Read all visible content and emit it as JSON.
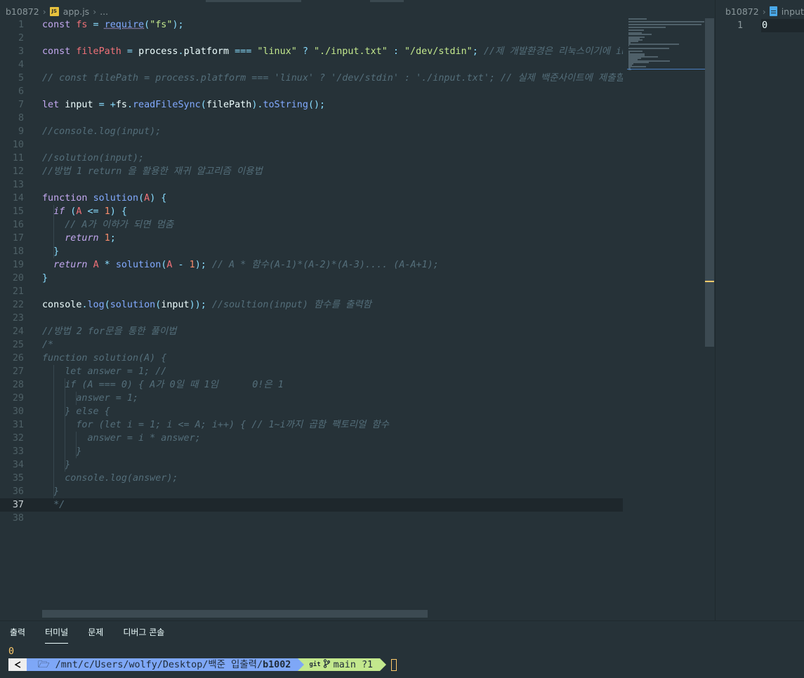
{
  "left_breadcrumb": {
    "folder": "b10872",
    "file": "app.js",
    "more": "...",
    "file_icon": "js-file-icon"
  },
  "right_breadcrumb": {
    "folder": "b10872",
    "file": "input",
    "file_icon": "text-file-icon"
  },
  "editor": {
    "current_line": 37,
    "lines": [
      [
        [
          "t-keyword",
          "const "
        ],
        [
          "t-var",
          "fs"
        ],
        [
          "t-op",
          " = "
        ],
        [
          "t-fn t-underline",
          "require"
        ],
        [
          "t-punc",
          "("
        ],
        [
          "t-str",
          "\"fs\""
        ],
        [
          "t-punc",
          ");"
        ]
      ],
      [],
      [
        [
          "t-keyword",
          "const "
        ],
        [
          "t-var",
          "filePath"
        ],
        [
          "t-op",
          " = "
        ],
        [
          "t-plain",
          "process"
        ],
        [
          "t-punc",
          "."
        ],
        [
          "t-plain",
          "platform"
        ],
        [
          "t-op",
          " === "
        ],
        [
          "t-str",
          "\"linux\""
        ],
        [
          "t-op",
          " ? "
        ],
        [
          "t-str",
          "\"./input.txt\""
        ],
        [
          "t-op",
          " : "
        ],
        [
          "t-str",
          "\"/dev/stdin\""
        ],
        [
          "t-punc",
          "; "
        ],
        [
          "t-comment",
          "//제 개발환경은 리눅스이기에 input.txt"
        ]
      ],
      [],
      [
        [
          "t-comment",
          "// const filePath = process.platform === 'linux' ? '/dev/stdin' : './input.txt'; // 실제 백준사이트에 제출할 때"
        ]
      ],
      [],
      [
        [
          "t-keyword",
          "let "
        ],
        [
          "t-plain",
          "input"
        ],
        [
          "t-op",
          " = +"
        ],
        [
          "t-plain",
          "fs"
        ],
        [
          "t-punc",
          "."
        ],
        [
          "t-fn",
          "readFileSync"
        ],
        [
          "t-punc",
          "("
        ],
        [
          "t-plain",
          "filePath"
        ],
        [
          "t-punc",
          ")."
        ],
        [
          "t-fn",
          "toString"
        ],
        [
          "t-punc",
          "();"
        ]
      ],
      [],
      [
        [
          "t-comment",
          "//console.log(input);"
        ]
      ],
      [],
      [
        [
          "t-comment",
          "//solution(input);"
        ]
      ],
      [
        [
          "t-comment",
          "//방법 1 return 을 활용한 재귀 알고리즘 이용법"
        ]
      ],
      [],
      [
        [
          "t-keyword",
          "function "
        ],
        [
          "t-fn",
          "solution"
        ],
        [
          "t-punc",
          "("
        ],
        [
          "t-var",
          "A"
        ],
        [
          "t-punc",
          ") {"
        ]
      ],
      [
        [
          "t-plain",
          "  "
        ],
        [
          "t-ctrl",
          "if"
        ],
        [
          "t-punc",
          " ("
        ],
        [
          "t-var",
          "A"
        ],
        [
          "t-op",
          " <= "
        ],
        [
          "t-num",
          "1"
        ],
        [
          "t-punc",
          ") {"
        ]
      ],
      [
        [
          "t-plain",
          "    "
        ],
        [
          "t-comment",
          "// A가 이하가 되면 멈춤"
        ]
      ],
      [
        [
          "t-plain",
          "    "
        ],
        [
          "t-ctrl",
          "return "
        ],
        [
          "t-num",
          "1"
        ],
        [
          "t-punc",
          ";"
        ]
      ],
      [
        [
          "t-punc",
          "  }"
        ]
      ],
      [
        [
          "t-plain",
          "  "
        ],
        [
          "t-ctrl",
          "return "
        ],
        [
          "t-var",
          "A"
        ],
        [
          "t-op",
          " * "
        ],
        [
          "t-fn",
          "solution"
        ],
        [
          "t-punc",
          "("
        ],
        [
          "t-var",
          "A"
        ],
        [
          "t-op",
          " - "
        ],
        [
          "t-num",
          "1"
        ],
        [
          "t-punc",
          "); "
        ],
        [
          "t-comment",
          "// A * 함수(A-1)*(A-2)*(A-3).... (A-A+1);"
        ]
      ],
      [
        [
          "t-punc",
          "}"
        ]
      ],
      [],
      [
        [
          "t-plain",
          "console"
        ],
        [
          "t-punc",
          "."
        ],
        [
          "t-fn",
          "log"
        ],
        [
          "t-punc",
          "("
        ],
        [
          "t-fn",
          "solution"
        ],
        [
          "t-punc",
          "("
        ],
        [
          "t-plain",
          "input"
        ],
        [
          "t-punc",
          "));"
        ],
        [
          "t-plain",
          " "
        ],
        [
          "t-comment",
          "//soultion(input) 함수를 출력함"
        ]
      ],
      [],
      [
        [
          "t-comment",
          "//방법 2 for문을 통한 풀이법"
        ]
      ],
      [
        [
          "t-comment",
          "/*"
        ]
      ],
      [
        [
          "t-comment",
          "function solution(A) {"
        ]
      ],
      [
        [
          "t-comment",
          "    let answer = 1; //"
        ]
      ],
      [
        [
          "t-comment",
          "    if (A === 0) { A가 0일 때 1임      0!은 1"
        ]
      ],
      [
        [
          "t-comment",
          "      answer = 1;"
        ]
      ],
      [
        [
          "t-comment",
          "    } else {"
        ]
      ],
      [
        [
          "t-comment",
          "      for (let i = 1; i <= A; i++) { // 1~i까지 곱함 팩토리얼 함수"
        ]
      ],
      [
        [
          "t-comment",
          "        answer = i * answer;"
        ]
      ],
      [
        [
          "t-comment",
          "      }"
        ]
      ],
      [
        [
          "t-comment",
          "    }"
        ]
      ],
      [
        [
          "t-comment",
          "    console.log(answer);"
        ]
      ],
      [
        [
          "t-comment",
          "  }"
        ]
      ],
      [
        [
          "t-comment",
          "  */"
        ]
      ],
      []
    ]
  },
  "input_file": {
    "lines": [
      "0"
    ]
  },
  "panel": {
    "tabs": [
      "출력",
      "터미널",
      "문제",
      "디버그 콘솔"
    ],
    "active_tab": "터미널",
    "terminal_output": "0",
    "prompt": {
      "os_icon": "linux-icon",
      "path_prefix": "🗁 /mnt/c/Users/wolfy/Desktop/백준 입출력/",
      "path_last": "b1002",
      "git_label": "git",
      "branch": "main ?1"
    }
  },
  "colors": {
    "background": "#263238",
    "keyword": "#c3a8ef",
    "function": "#82aaff",
    "string": "#c3e88d",
    "comment": "#546e7a",
    "variable": "#f07178",
    "number": "#f78c6c",
    "path_segment": "#7ea7f7",
    "git_segment": "#c3e88d",
    "cursor": "#ffcb6b"
  }
}
